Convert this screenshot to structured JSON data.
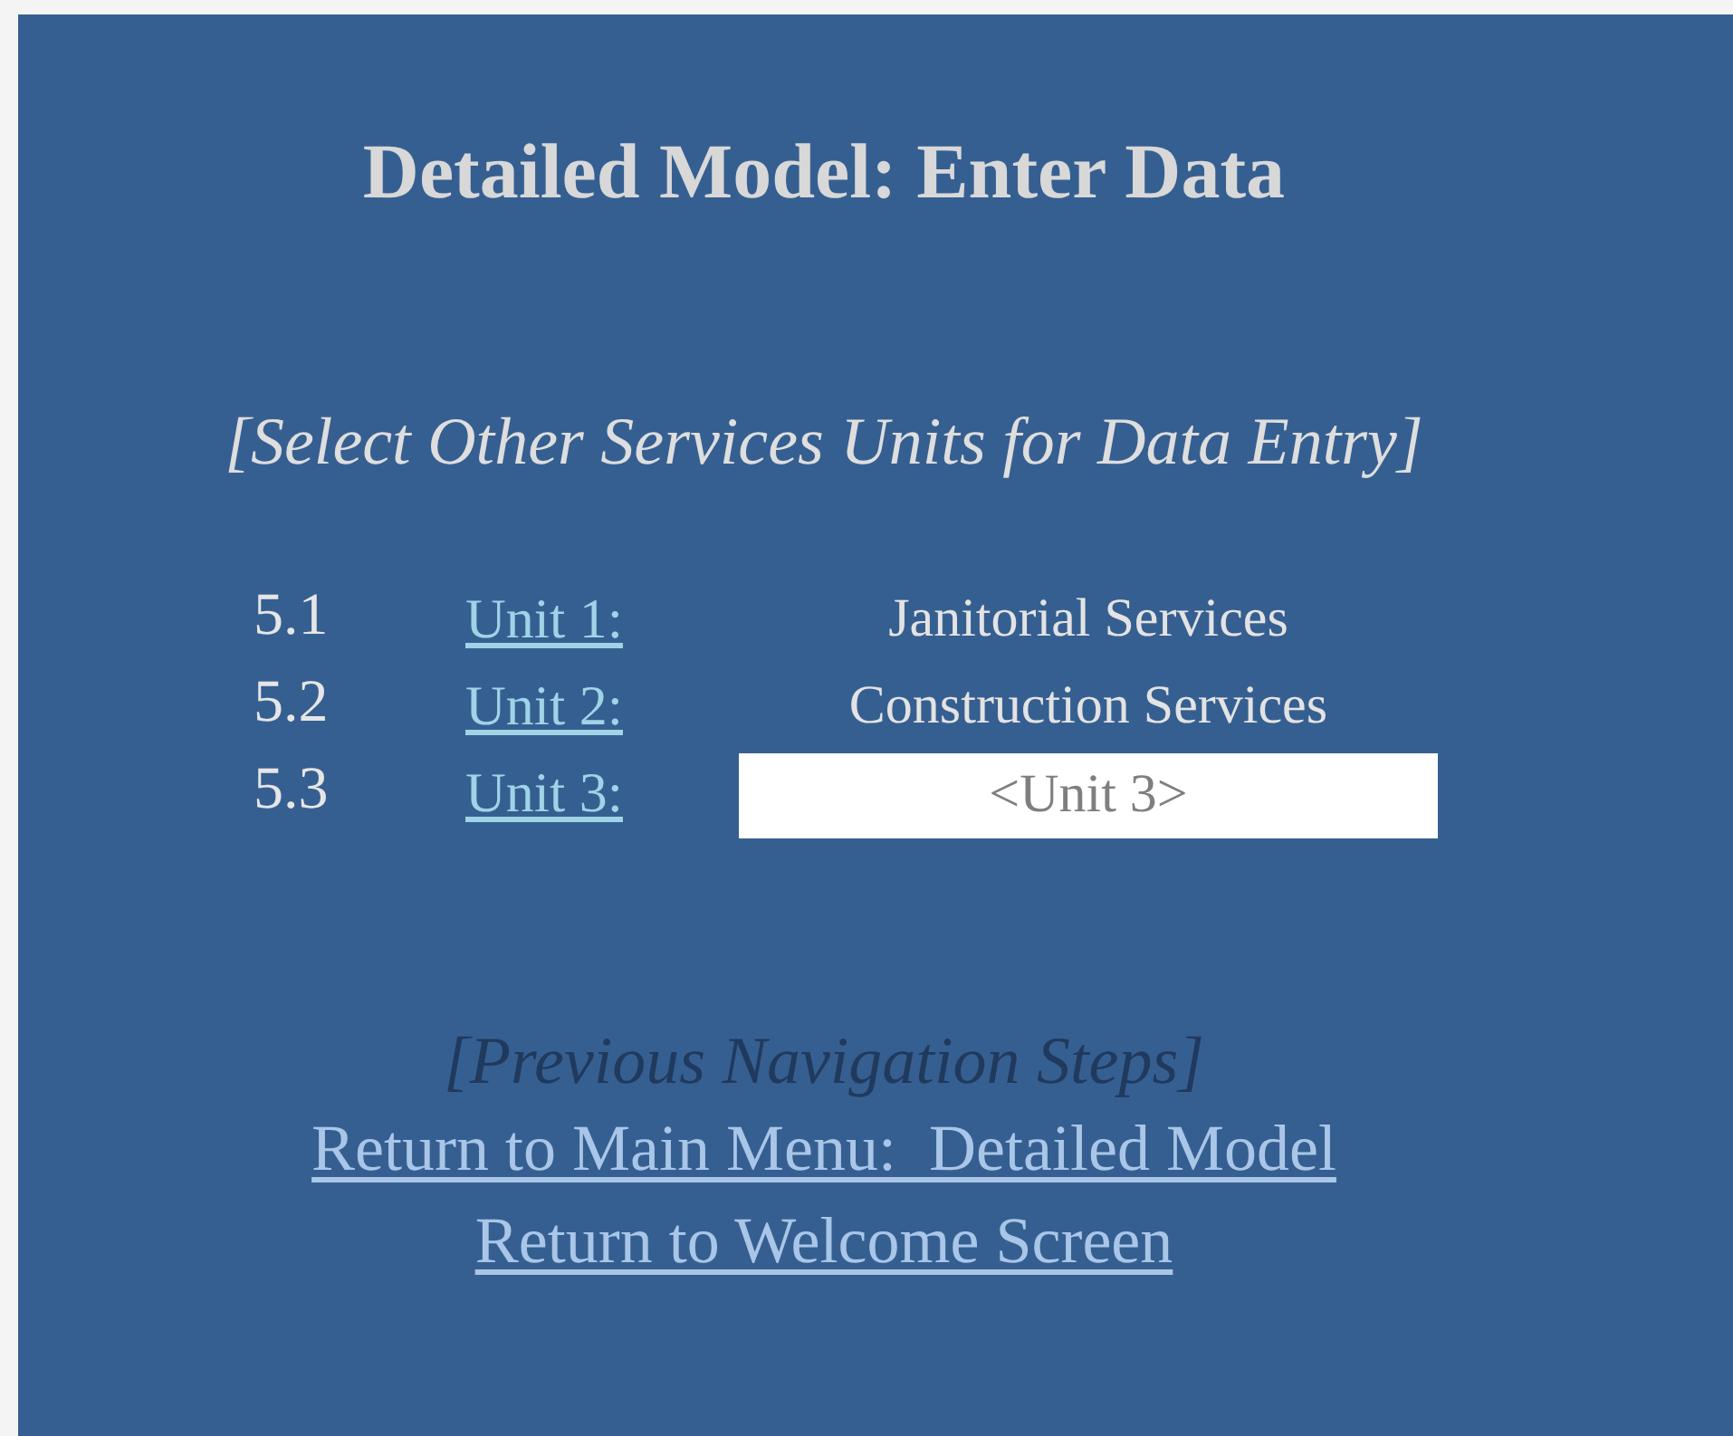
{
  "title": "Detailed Model: Enter Data",
  "subtitle": "[Select Other Services Units for Data Entry]",
  "units": [
    {
      "number": "5.1",
      "link": "Unit 1:",
      "kind": "text",
      "name": "Janitorial Services"
    },
    {
      "number": "5.2",
      "link": "Unit 2:",
      "kind": "text",
      "name": "Construction Services"
    },
    {
      "number": "5.3",
      "link": "Unit 3:",
      "kind": "field",
      "placeholder": "<Unit 3>"
    }
  ],
  "navigation": {
    "heading": "[Previous Navigation Steps]",
    "links": [
      "Return to Main Menu:  Detailed Model",
      "Return to Welcome Screen"
    ]
  }
}
